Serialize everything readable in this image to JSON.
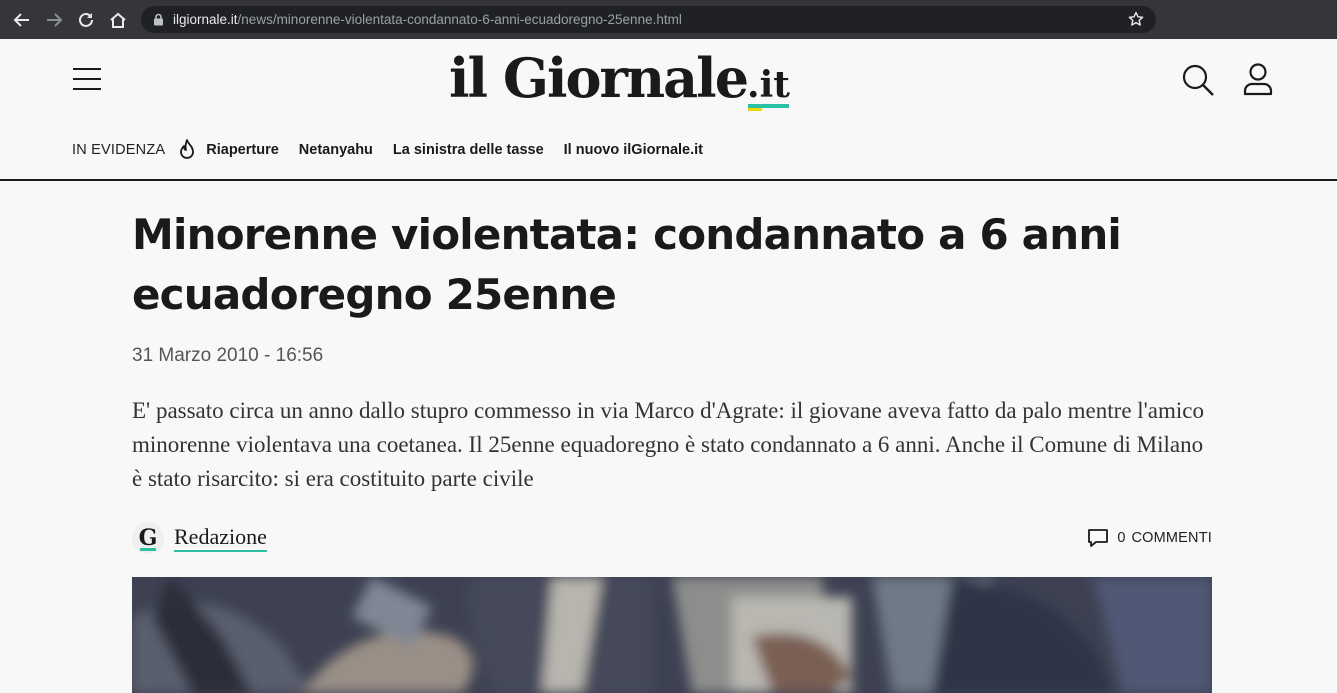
{
  "browser": {
    "url_host": "ilgiornale.it",
    "url_path": "/news/minorenne-violentata-condannato-6-anni-ecuadoregno-25enne.html"
  },
  "header": {
    "logo_main": "il Giornale",
    "logo_suffix": ".it",
    "evidenza_label": "IN EVIDENZA",
    "evidenza_links": [
      "Riaperture",
      "Netanyahu",
      "La sinistra delle tasse",
      "Il nuovo ilGiornale.it"
    ]
  },
  "article": {
    "title": "Minorenne violentata: condannato a 6 anni ecuadoregno 25enne",
    "date": "31 Marzo 2010 - 16:56",
    "summary": "E' passato circa un anno dallo stupro commesso in via Marco d'Agrate: il giovane aveva fatto da palo mentre l'amico minorenne violentava una coetanea. Il 25enne equadoregno  è stato condannato a 6 anni. Anche il Comune di Milano è stato risarcito: si era costituito parte civile",
    "author_logo_letter": "G",
    "author": "Redazione",
    "comments_count": "0",
    "comments_label": "COMMENTI"
  },
  "colors": {
    "accent": "#2bbfa4",
    "accent_yellow": "#f2d600",
    "browser_bar": "#35363a",
    "omnibox": "#202124",
    "page_bg": "#f8f8f8"
  }
}
